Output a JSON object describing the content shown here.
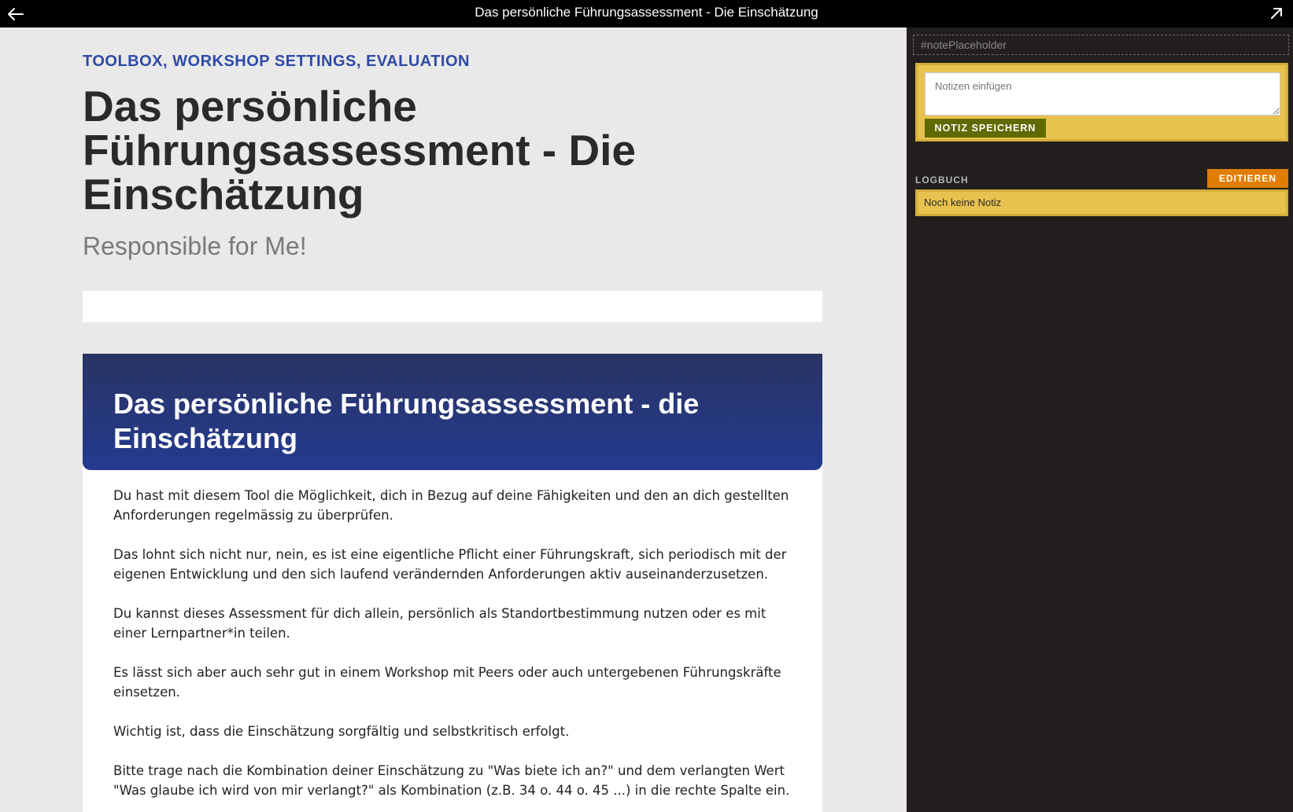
{
  "topbar": {
    "title": "Das persönliche Führungsassessment - Die Einschätzung",
    "back_icon": "arrow-left-icon",
    "expand_icon": "arrow-up-right-icon"
  },
  "main": {
    "breadcrumb": "TOOLBOX, WORKSHOP SETTINGS, EVALUATION",
    "title": "Das persönliche Führungsassessment - Die Einschätzung",
    "subtitle": "Responsible for Me!",
    "card": {
      "heading": "Das persönliche Führungsassessment - die Einschätzung",
      "paragraphs": [
        "Du hast mit diesem Tool die Möglichkeit, dich in Bezug auf deine Fähigkeiten und den an dich gestellten Anforderungen regelmässig zu überprüfen.",
        "Das lohnt sich nicht nur, nein, es ist eine eigentliche Pflicht einer Führungskraft, sich periodisch mit der eigenen Entwicklung und den sich laufend verändernden Anforderungen aktiv auseinanderzusetzen.",
        "Du kannst dieses Assessment für dich allein, persönlich als Standortbestimmung nutzen oder es mit einer Lernpartner*in teilen.",
        "Es lässt sich aber auch sehr gut in einem Workshop mit Peers oder auch untergebenen Führungskräfte einsetzen.",
        "Wichtig ist, dass die Einschätzung sorgfältig und selbstkritisch erfolgt.",
        "Bitte trage nach die Kombination deiner Einschätzung zu \"Was biete ich an?\" und dem verlangten Wert \"Was glaube ich wird von mir verlangt?\" als Kombination (z.B. 34 o. 44 o. 45 ...) in die rechte Spalte ein."
      ]
    }
  },
  "sidebar": {
    "note_placeholder_label": "#notePlaceholder",
    "note_input_placeholder": "Notizen einfügen",
    "save_label": "NOTIZ SPEICHERN",
    "logbuch_label": "LOGBUCH",
    "edit_label": "EDITIEREN",
    "log_entry": "Noch keine Notiz"
  },
  "colors": {
    "accent_blue": "#2e4aa6",
    "note_yellow": "#e8c24f",
    "save_green": "#5d6b00",
    "edit_orange": "#e07d00",
    "sidebar_bg": "#221f1e"
  }
}
